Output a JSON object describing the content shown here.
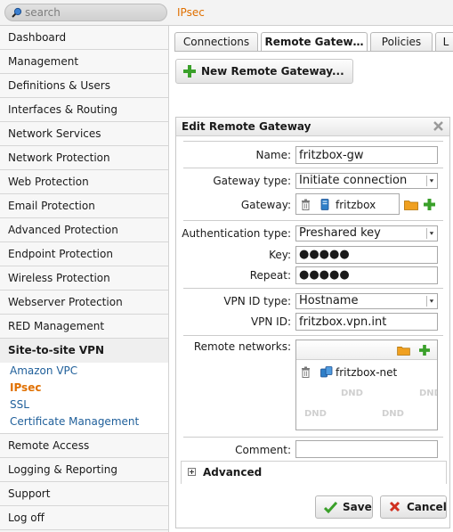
{
  "search": {
    "placeholder": "search"
  },
  "breadcrumb": "IPsec",
  "sidebar": {
    "items_top": [
      "Dashboard",
      "Management",
      "Definitions & Users",
      "Interfaces & Routing",
      "Network Services",
      "Network Protection",
      "Web Protection",
      "Email Protection",
      "Advanced Protection",
      "Endpoint Protection",
      "Wireless Protection",
      "Webserver Protection",
      "RED Management"
    ],
    "group": {
      "label": "Site-to-site VPN",
      "subitems": [
        "Amazon VPC",
        "IPsec",
        "SSL",
        "Certificate Management"
      ],
      "active": "IPsec"
    },
    "items_bottom": [
      "Remote Access",
      "Logging & Reporting",
      "Support",
      "Log off"
    ]
  },
  "tabs": [
    "Connections",
    "Remote Gatew…",
    "Policies",
    "L"
  ],
  "active_tab": "Remote Gatew…",
  "new_button": "New Remote Gateway...",
  "panel": {
    "title": "Edit Remote Gateway",
    "name_label": "Name:",
    "name_value": "fritzbox-gw",
    "gateway_type_label": "Gateway type:",
    "gateway_type_value": "Initiate connection",
    "gateway_label": "Gateway:",
    "gateway_value": "fritzbox",
    "auth_type_label": "Authentication type:",
    "auth_type_value": "Preshared key",
    "key_label": "Key:",
    "key_value": "●●●●●",
    "repeat_label": "Repeat:",
    "repeat_value": "●●●●●",
    "vpn_id_type_label": "VPN ID type:",
    "vpn_id_type_value": "Hostname",
    "vpn_id_label": "VPN ID:",
    "vpn_id_value": "fritzbox.vpn.int",
    "remote_networks_label": "Remote networks:",
    "remote_network_item": "fritzbox-net",
    "dnd_text": "DND",
    "comment_label": "Comment:",
    "comment_value": "",
    "advanced_label": "Advanced",
    "save_label": "Save",
    "cancel_label": "Cancel"
  },
  "colors": {
    "accent": "#e07000",
    "link": "#1f5f9a",
    "green": "#3aa02a",
    "red": "#d03020",
    "folder": "#f0a020"
  }
}
